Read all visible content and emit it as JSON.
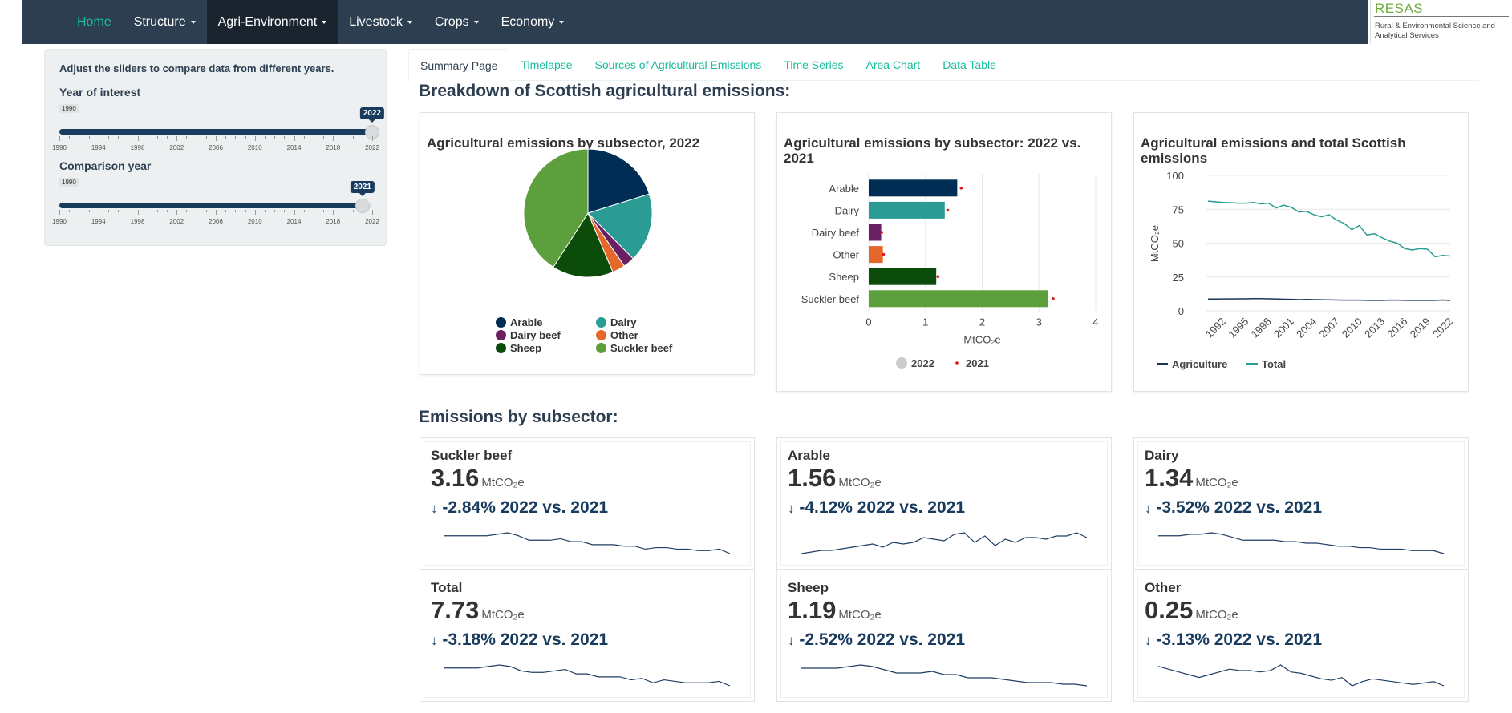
{
  "nav": {
    "items": [
      {
        "label": "Home",
        "dropdown": false,
        "active": false,
        "home": true
      },
      {
        "label": "Structure",
        "dropdown": true,
        "active": false
      },
      {
        "label": "Agri-Environment",
        "dropdown": true,
        "active": true
      },
      {
        "label": "Livestock",
        "dropdown": true,
        "active": false
      },
      {
        "label": "Crops",
        "dropdown": true,
        "active": false
      },
      {
        "label": "Economy",
        "dropdown": true,
        "active": false
      }
    ],
    "logo_title": "RESAS",
    "logo_sub": "Rural & Environmental Science and Analytical Services"
  },
  "sidebar": {
    "intro": "Adjust the sliders to compare data from different years.",
    "year_of_interest": {
      "label": "Year of interest",
      "min": 1990,
      "max": 2022,
      "value": 2022,
      "min_label": "1990",
      "value_label": "2022"
    },
    "comparison_year": {
      "label": "Comparison year",
      "min": 1990,
      "max": 2022,
      "value": 2021,
      "min_label": "1990",
      "value_label": "2021"
    },
    "tick_labels": [
      "1990",
      "1994",
      "1998",
      "2002",
      "2006",
      "2010",
      "2014",
      "2018",
      "2022"
    ]
  },
  "tabs": [
    "Summary Page",
    "Timelapse",
    "Sources of Agricultural Emissions",
    "Time Series",
    "Area Chart",
    "Data Table"
  ],
  "breakdown_heading": "Breakdown of Scottish agricultural emissions:",
  "subsector_heading": "Emissions by subsector:",
  "colors": {
    "arable": "#002d54",
    "dairy": "#2b9c93",
    "dairy_beef": "#6a2063",
    "other": "#e5682a",
    "sheep": "#0b4c0b",
    "suckler_beef": "#5d9f3c",
    "accent": "#18bc9c",
    "navy": "#2c3e50",
    "marker_2021": "#e31a1c"
  },
  "chart_data": [
    {
      "type": "pie",
      "title": "Agricultural emissions by subsector, 2022",
      "categories": [
        "Arable",
        "Dairy",
        "Dairy beef",
        "Other",
        "Sheep",
        "Suckler beef"
      ],
      "values": [
        1.56,
        1.34,
        0.22,
        0.25,
        1.19,
        3.16
      ]
    },
    {
      "type": "bar",
      "title": "Agricultural emissions by subsector: 2022 vs. 2021",
      "categories": [
        "Arable",
        "Dairy",
        "Dairy beef",
        "Other",
        "Sheep",
        "Suckler beef"
      ],
      "series": [
        {
          "name": "2022",
          "values": [
            1.56,
            1.34,
            0.22,
            0.25,
            1.19,
            3.16
          ]
        },
        {
          "name": "2021",
          "values": [
            1.63,
            1.39,
            0.23,
            0.26,
            1.22,
            3.25
          ]
        }
      ],
      "xlabel": "MtCO₂e",
      "xlim": [
        0,
        4
      ],
      "xticks": [
        "0",
        "1",
        "2",
        "3",
        "4"
      ],
      "legend": "bottom"
    },
    {
      "type": "line",
      "title": "Agricultural emissions and total Scottish emissions",
      "ylabel": "MtCO₂e",
      "ylim": [
        0,
        100
      ],
      "yticks": [
        "0",
        "25",
        "50",
        "75",
        "100"
      ],
      "xticks": [
        "1992",
        "1995",
        "1998",
        "2001",
        "2004",
        "2007",
        "2010",
        "2013",
        "2016",
        "2019",
        "2022"
      ],
      "x": [
        1990,
        1991,
        1992,
        1993,
        1994,
        1995,
        1996,
        1997,
        1998,
        1999,
        2000,
        2001,
        2002,
        2003,
        2004,
        2005,
        2006,
        2007,
        2008,
        2009,
        2010,
        2011,
        2012,
        2013,
        2014,
        2015,
        2016,
        2017,
        2018,
        2019,
        2020,
        2021,
        2022
      ],
      "series": [
        {
          "name": "Agriculture",
          "values": [
            8.7,
            8.7,
            8.8,
            8.8,
            8.9,
            8.9,
            9.0,
            9.0,
            8.9,
            8.8,
            8.6,
            8.5,
            8.3,
            8.4,
            8.3,
            8.2,
            8.1,
            8.0,
            7.9,
            7.9,
            7.9,
            7.8,
            7.8,
            7.8,
            7.9,
            7.9,
            7.8,
            7.8,
            7.8,
            7.8,
            7.8,
            8.0,
            7.7
          ]
        },
        {
          "name": "Total",
          "values": [
            81,
            80.5,
            80,
            79.8,
            79.5,
            79.5,
            80,
            79,
            79.5,
            76,
            78,
            76.5,
            73,
            73.5,
            71,
            69.5,
            71,
            67,
            64.5,
            60,
            63,
            56,
            57,
            54,
            51.5,
            50,
            46,
            45,
            46,
            45.5,
            40,
            41,
            40.5
          ]
        }
      ],
      "legend": "bottom"
    }
  ],
  "kpis": [
    {
      "name": "Suckler beef",
      "value": "3.16",
      "unit": "MtCO₂e",
      "change": "-2.84% 2022 vs. 2021",
      "arrow": "↓",
      "spark": [
        10,
        10,
        10,
        10,
        10,
        11,
        12,
        10,
        7,
        7,
        7,
        8,
        6,
        6,
        4,
        4,
        4,
        3,
        3,
        1,
        2,
        2,
        1,
        1,
        0,
        0,
        1,
        -2
      ]
    },
    {
      "name": "Arable",
      "value": "1.56",
      "unit": "MtCO₂e",
      "change": "-4.12% 2022 vs. 2021",
      "arrow": "↓",
      "spark": [
        1,
        2,
        3,
        3,
        4,
        5,
        6,
        7,
        5,
        8,
        7,
        8,
        11,
        10,
        9,
        13,
        14,
        8,
        12,
        6,
        10,
        8,
        11,
        11,
        10,
        12,
        12,
        14,
        11
      ]
    },
    {
      "name": "Dairy",
      "value": "1.34",
      "unit": "MtCO₂e",
      "change": "-3.52% 2022 vs. 2021",
      "arrow": "↓",
      "spark": [
        10,
        10,
        10,
        11,
        11,
        12,
        11,
        9,
        7,
        7,
        7,
        7,
        6,
        6,
        5,
        5,
        4,
        3,
        3,
        2,
        2,
        1,
        1,
        1,
        0,
        0,
        0,
        -2
      ]
    },
    {
      "name": "Total",
      "value": "7.73",
      "unit": "MtCO₂e",
      "change": "-3.18% 2022 vs. 2021",
      "arrow": "↓",
      "spark": [
        10,
        10,
        10,
        10,
        11,
        12,
        11,
        8,
        7,
        7,
        8,
        9,
        6,
        6,
        4,
        4,
        4,
        2,
        3,
        0,
        2,
        1,
        0,
        0,
        0,
        1,
        -2
      ]
    },
    {
      "name": "Sheep",
      "value": "1.19",
      "unit": "MtCO₂e",
      "change": "-2.52% 2022 vs. 2021",
      "arrow": "↓",
      "spark": [
        10,
        10,
        10,
        10,
        11,
        12,
        11,
        9,
        7,
        7,
        7,
        8,
        6,
        6,
        4,
        4,
        4,
        3,
        2,
        1,
        1,
        1,
        0,
        0,
        -1
      ]
    },
    {
      "name": "Other",
      "value": "0.25",
      "unit": "MtCO₂e",
      "change": "-3.13% 2022 vs. 2021",
      "arrow": "↓",
      "spark": [
        12,
        10,
        8,
        6,
        4,
        6,
        8,
        10,
        9,
        9,
        8,
        9,
        13,
        8,
        7,
        5,
        3,
        2,
        4,
        -2,
        1,
        3,
        2,
        1,
        0,
        -1,
        0,
        1,
        -2
      ]
    }
  ]
}
